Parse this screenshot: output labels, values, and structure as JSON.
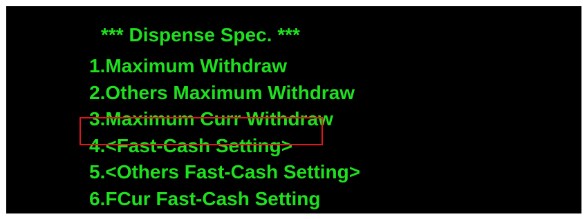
{
  "screen": {
    "title": "*** Dispense Spec. ***",
    "menu": {
      "items": [
        {
          "label": "1.Maximum Withdraw"
        },
        {
          "label": "2.Others Maximum Withdraw"
        },
        {
          "label": "3.Maximum Curr Withdraw"
        },
        {
          "label": "4.<Fast-Cash Setting>",
          "highlighted": true
        },
        {
          "label": "5.<Others Fast-Cash Setting>"
        },
        {
          "label": "6.FCur Fast-Cash Setting"
        }
      ]
    }
  },
  "colors": {
    "background": "#000000",
    "text": "#1fe01f",
    "highlight_border": "#e0161b"
  }
}
